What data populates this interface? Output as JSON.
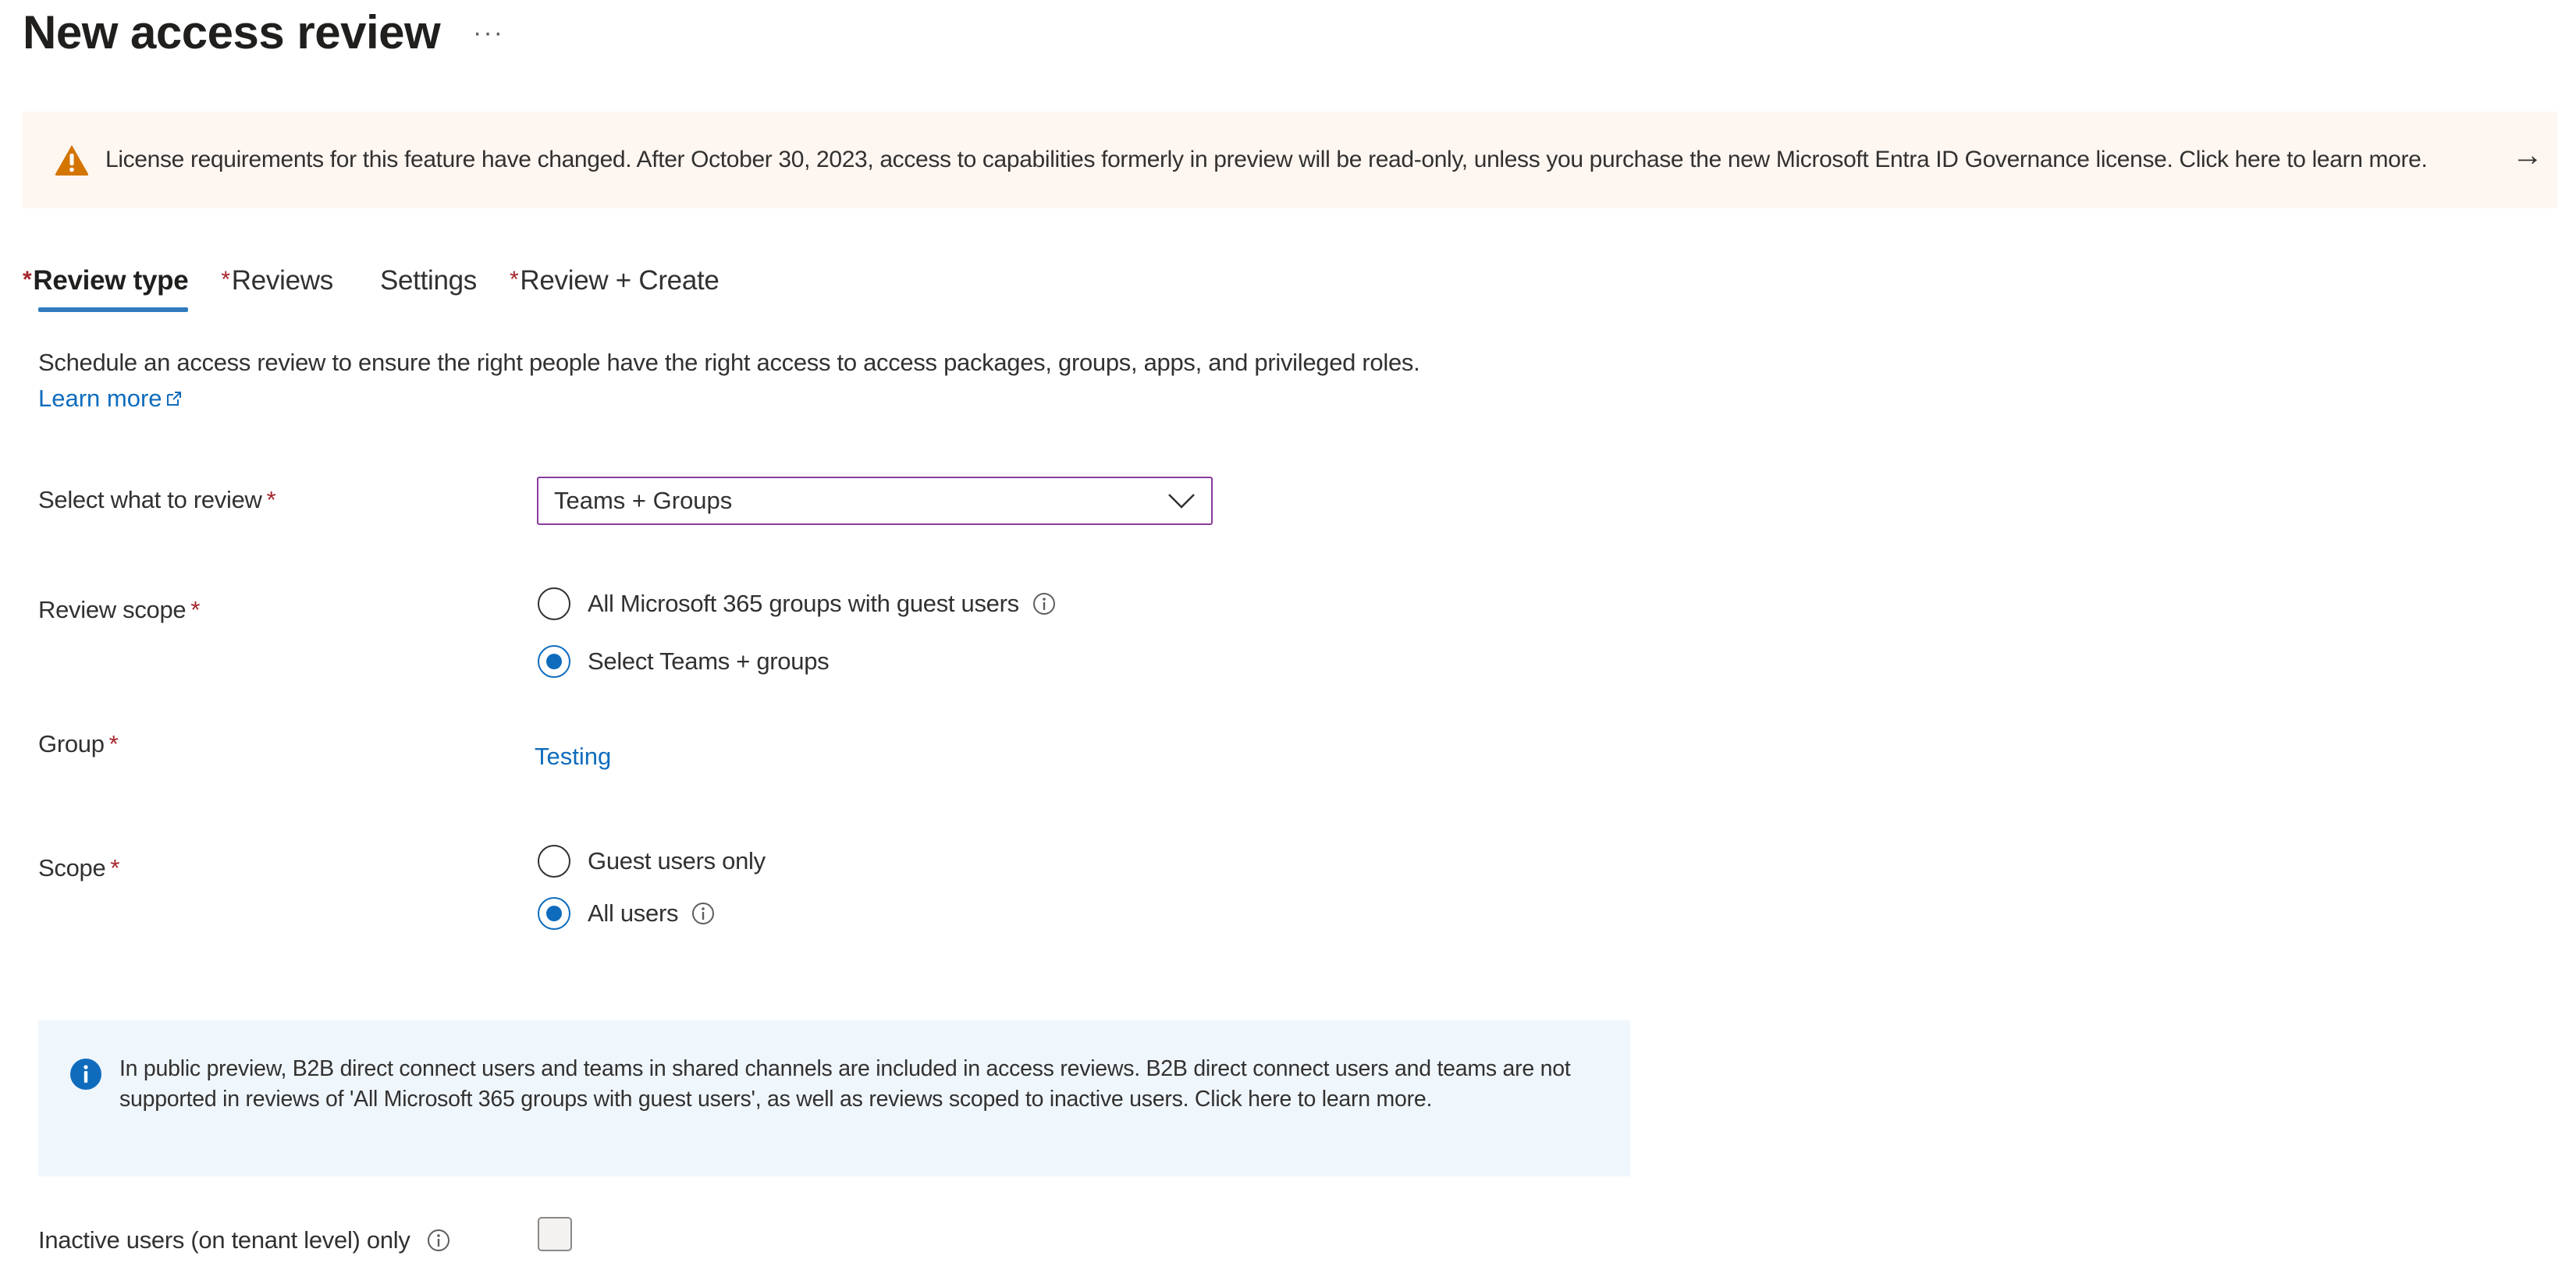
{
  "header": {
    "title": "New access review",
    "more_label": "···"
  },
  "banner": {
    "icon": "warning-icon",
    "text": "License requirements for this feature have changed. After October 30, 2023, access to capabilities formerly in preview will be read-only, unless you purchase the new Microsoft Entra ID Governance license. Click here to learn more.",
    "arrow": "→",
    "background": "#fdf6f1",
    "icon_color": "#d47500"
  },
  "tabs": [
    {
      "label": "Review type",
      "required": true,
      "active": true
    },
    {
      "label": "Reviews",
      "required": true,
      "active": false
    },
    {
      "label": "Settings",
      "required": false,
      "active": false
    },
    {
      "label": "Review + Create",
      "required": true,
      "active": false
    }
  ],
  "required_marker": "*",
  "description": {
    "text": "Schedule an access review to ensure the right people have the right access to access packages, groups, apps, and privileged roles.",
    "learn_more": "Learn more"
  },
  "form": {
    "select_what": {
      "label": "Select what to review",
      "value": "Teams + Groups"
    },
    "review_scope": {
      "label": "Review scope",
      "options": [
        {
          "label": "All Microsoft 365 groups with guest users",
          "checked": false,
          "info": true
        },
        {
          "label": "Select Teams + groups",
          "checked": true,
          "info": false
        }
      ]
    },
    "group": {
      "label": "Group",
      "value": "Testing"
    },
    "scope": {
      "label": "Scope",
      "options": [
        {
          "label": "Guest users only",
          "checked": false,
          "info": false
        },
        {
          "label": "All users",
          "checked": true,
          "info": true
        }
      ]
    },
    "info_box": {
      "text": "In public preview, B2B direct connect users and teams in shared channels are included in access reviews. B2B direct connect users and teams are not supported in reviews of 'All Microsoft 365 groups with guest users', as well as reviews scoped to inactive users. Click here to learn more."
    },
    "inactive_users": {
      "label": "Inactive users (on tenant level) only",
      "checked": false
    }
  },
  "colors": {
    "accent": "#0f6cbd",
    "required": "#a4262c",
    "tab_underline": "#2f7bbd",
    "dropdown_border": "#8a3c9e",
    "info_bg": "#eff6fc"
  }
}
